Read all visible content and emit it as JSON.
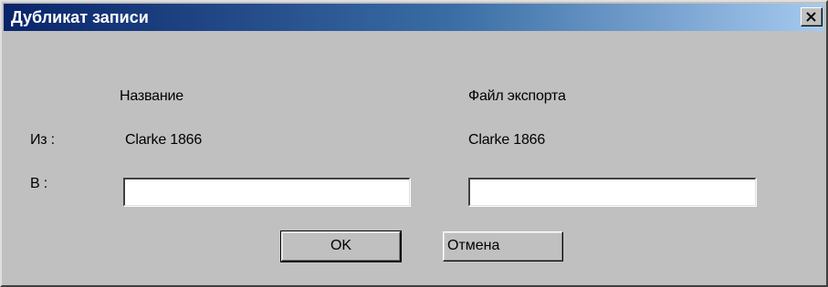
{
  "window": {
    "title": "Дубликат записи"
  },
  "columns": {
    "name_header": "Название",
    "export_header": "Файл экспорта"
  },
  "rows": {
    "from_label": "Из :",
    "from_name": "Clarke 1866",
    "from_export": "Clarke 1866",
    "to_label": "В :"
  },
  "fields": {
    "to_name_value": "",
    "to_export_value": ""
  },
  "buttons": {
    "ok_label": "OK",
    "cancel_label": "Отмена"
  },
  "icons": {
    "close": "close-icon"
  },
  "colors": {
    "face": "#c0c0c0",
    "title_start": "#0a246a",
    "title_end": "#a6caf0"
  }
}
